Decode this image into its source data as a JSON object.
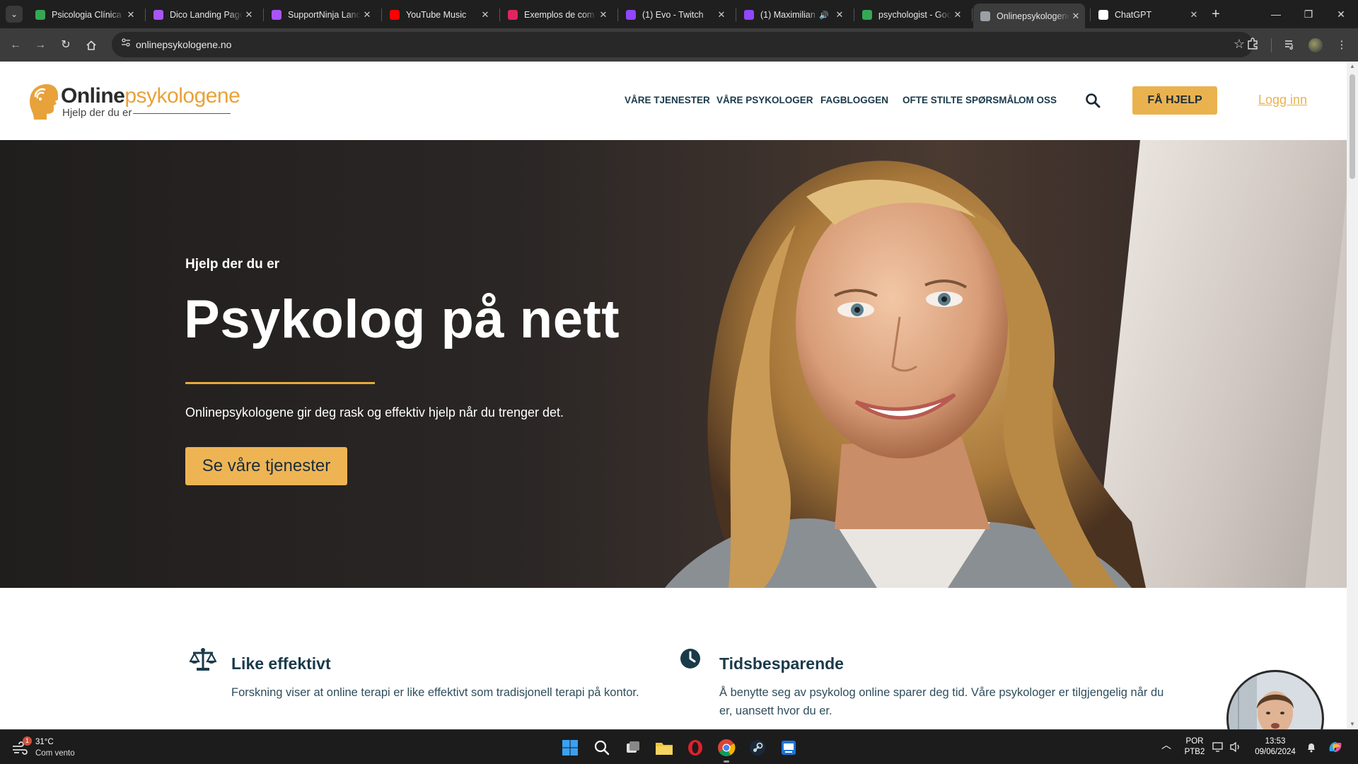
{
  "browser": {
    "tabs": [
      {
        "title": "Psicologia Clínica",
        "favicon": "maps-pin-icon",
        "color": "#34a853",
        "active": false
      },
      {
        "title": "Dico Landing Page",
        "favicon": "lightning-icon",
        "color": "#a855f7",
        "active": false
      },
      {
        "title": "SupportNinja Landing",
        "favicon": "lightning-icon",
        "color": "#a855f7",
        "active": false
      },
      {
        "title": "YouTube Music",
        "favicon": "youtube-music-icon",
        "color": "#ff0000",
        "active": false
      },
      {
        "title": "Exemplos de com",
        "favicon": "refresh-c-icon",
        "color": "#e0245e",
        "active": false
      },
      {
        "title": "(1) Evo - Twitch",
        "favicon": "twitch-icon",
        "color": "#9146ff",
        "active": false
      },
      {
        "title": "(1) Maximilian",
        "favicon": "twitch-icon",
        "color": "#9146ff",
        "active": false,
        "audio": true
      },
      {
        "title": "psychologist - Google",
        "favicon": "maps-pin-icon",
        "color": "#34a853",
        "active": false
      },
      {
        "title": "Onlinepsykologene",
        "favicon": "globe-icon",
        "color": "#9aa0a6",
        "active": true
      },
      {
        "title": "ChatGPT",
        "favicon": "openai-icon",
        "color": "#ffffff",
        "active": false
      }
    ],
    "url": "onlinepsykologene.no"
  },
  "site": {
    "logo": {
      "word_bold": "Online",
      "word_accent": "psykologene",
      "tagline": "Hjelp der du er"
    },
    "nav": [
      "VÅRE TJENESTER",
      "VÅRE PSYKOLOGER",
      "FAGBLOGGEN",
      "OFTE STILTE SPØRSMÅL",
      "OM OSS"
    ],
    "cta": "FÅ HJELP",
    "login": "Logg inn",
    "hero": {
      "kicker": "Hjelp der du er",
      "title": "Psykolog på nett",
      "subtitle": "Onlinepsykologene gir deg rask og effektiv hjelp når du trenger det.",
      "button": "Se våre tjenester"
    },
    "features": [
      {
        "icon": "scale-icon",
        "title": "Like effektivt",
        "text": "Forskning viser at online terapi er like effektivt som tradisjonell terapi på kontor."
      },
      {
        "icon": "clock-icon",
        "title": "Tidsbesparende",
        "text": "Å benytte seg av psykolog online sparer deg tid. Våre psykologer er tilgjengelig når du er, uansett hvor du er."
      }
    ],
    "colors": {
      "accent": "#eab24f",
      "navy": "#1a3a4a"
    }
  },
  "taskbar": {
    "weather_temp": "31°C",
    "weather_cond": "Com vento",
    "weather_badge": "1",
    "lang_top": "POR",
    "lang_bottom": "PTB2",
    "time": "13:53",
    "date": "09/06/2024"
  }
}
